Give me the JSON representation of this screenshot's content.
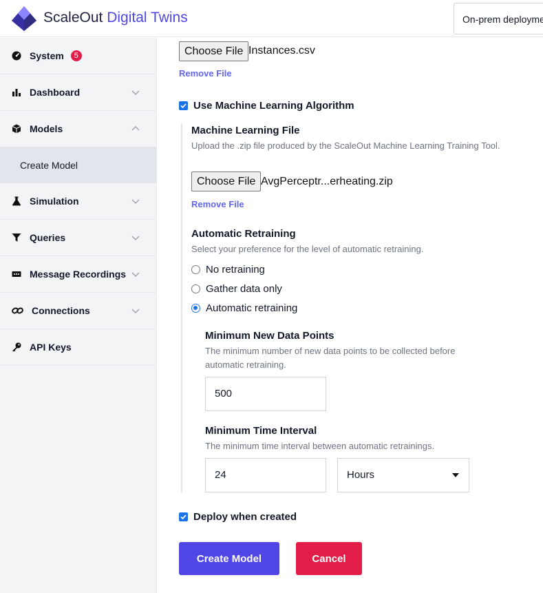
{
  "header": {
    "brand_part1": "ScaleOut ",
    "brand_part2": "Digital Twins",
    "environment_label": "On-prem deployme"
  },
  "sidebar": {
    "system": {
      "label": "System",
      "badge": "5"
    },
    "dashboard": {
      "label": "Dashboard"
    },
    "models": {
      "label": "Models",
      "sub_items": [
        "Create Model"
      ]
    },
    "simulation": {
      "label": "Simulation"
    },
    "queries": {
      "label": "Queries"
    },
    "message_recordings": {
      "label": "Message Recordings"
    },
    "connections": {
      "label": "Connections"
    },
    "api_keys": {
      "label": "API Keys"
    }
  },
  "form": {
    "instances_file": {
      "button_label": "Choose File",
      "file_name": "Instances.csv",
      "remove_label": "Remove File"
    },
    "use_ml": {
      "label": "Use Machine Learning Algorithm",
      "checked": true
    },
    "ml_file": {
      "title": "Machine Learning File",
      "help": "Upload the .zip file produced by the ScaleOut Machine Learning Training Tool.",
      "button_label": "Choose File",
      "file_name": "AvgPerceptr...erheating.zip",
      "remove_label": "Remove File"
    },
    "retraining": {
      "title": "Automatic Retraining",
      "help": "Select your preference for the level of automatic retraining.",
      "options": [
        "No retraining",
        "Gather data only",
        "Automatic retraining"
      ],
      "selected": "Automatic retraining"
    },
    "min_points": {
      "title": "Minimum New Data Points",
      "help": "The minimum number of new data points to be collected before automatic retraining.",
      "value": "500"
    },
    "min_interval": {
      "title": "Minimum Time Interval",
      "help": "The minimum time interval between automatic retrainings.",
      "value": "24",
      "unit": "Hours"
    },
    "deploy": {
      "label": "Deploy when created",
      "checked": true
    },
    "create_label": "Create Model",
    "cancel_label": "Cancel"
  },
  "colors": {
    "accent": "#4f46e5",
    "danger": "#e11d48",
    "checkbox": "#1a73e8",
    "link": "#6366f1"
  }
}
